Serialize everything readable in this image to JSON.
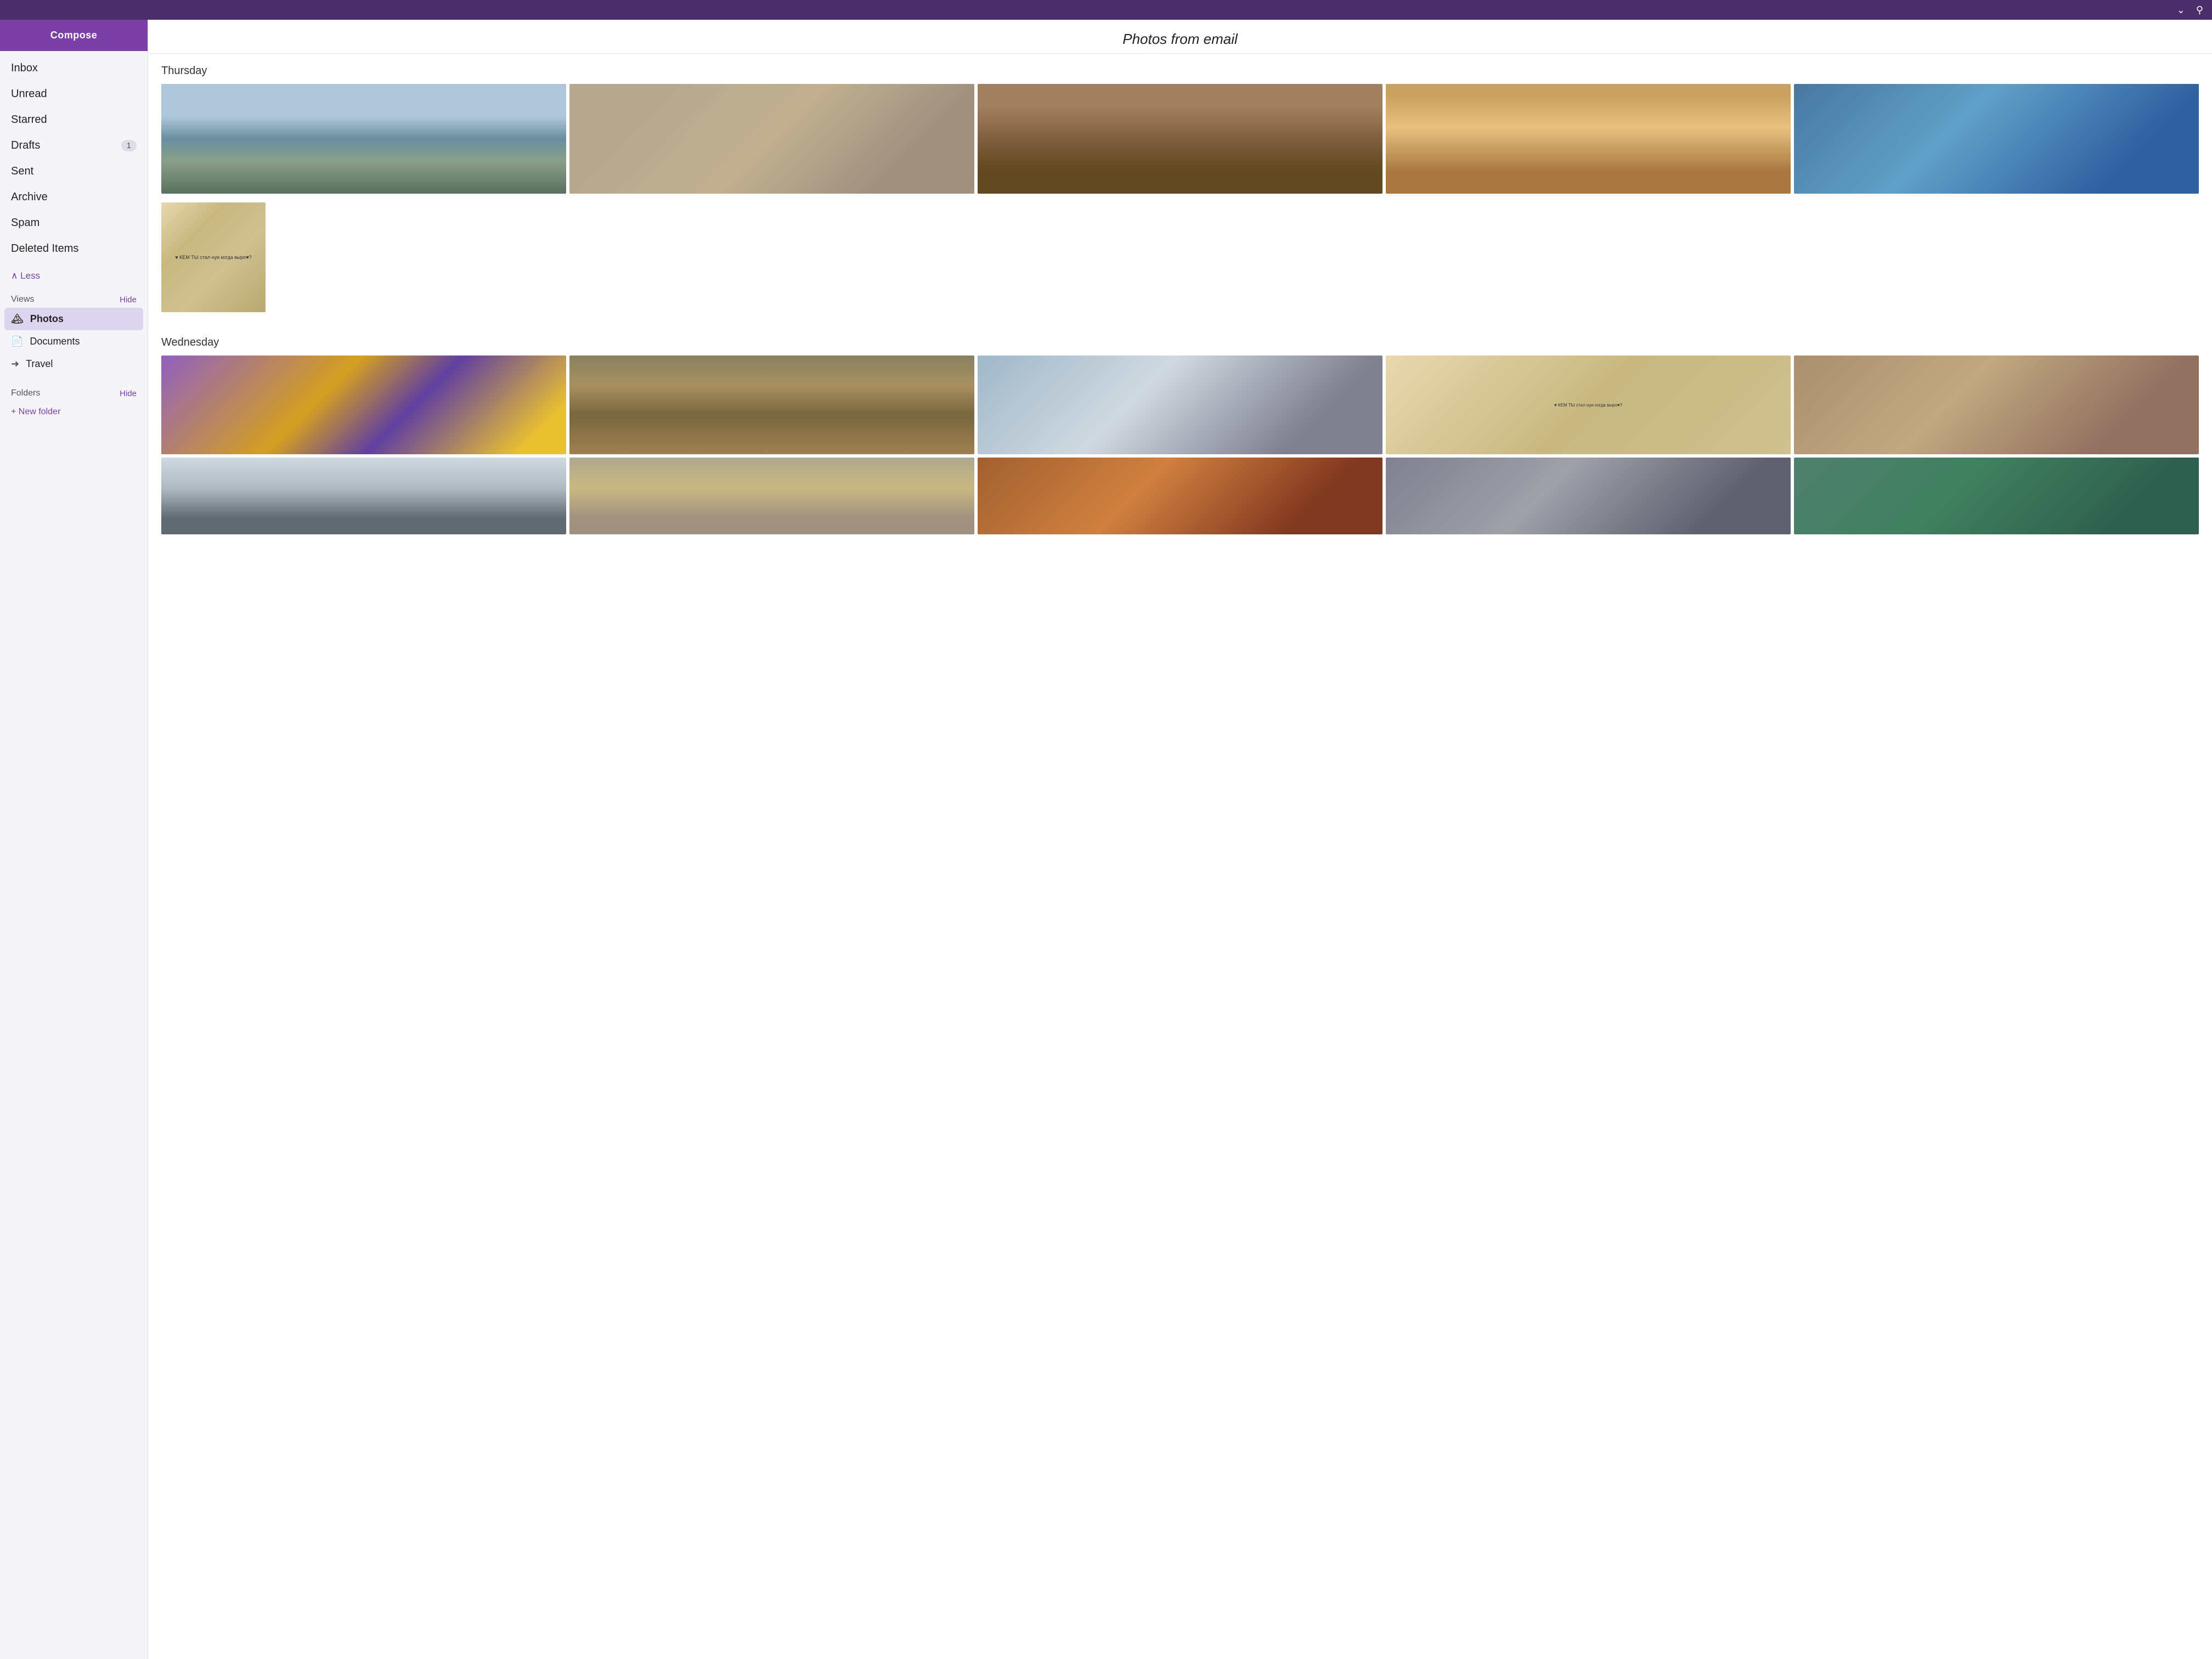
{
  "topbar": {
    "chevron_icon": "chevron-down",
    "search_icon": "search"
  },
  "sidebar": {
    "compose_label": "Compose",
    "nav_items": [
      {
        "label": "Inbox",
        "badge": null
      },
      {
        "label": "Unread",
        "badge": null
      },
      {
        "label": "Starred",
        "badge": null
      },
      {
        "label": "Drafts",
        "badge": "1"
      },
      {
        "label": "Sent",
        "badge": null
      },
      {
        "label": "Archive",
        "badge": null
      },
      {
        "label": "Spam",
        "badge": null
      },
      {
        "label": "Deleted Items",
        "badge": null
      }
    ],
    "less_toggle": "∧ Less",
    "views_label": "Views",
    "views_hide": "Hide",
    "views": [
      {
        "label": "Photos",
        "icon": "🏔",
        "active": true
      },
      {
        "label": "Documents",
        "icon": "📄",
        "active": false
      },
      {
        "label": "Travel",
        "icon": "➜",
        "active": false
      }
    ],
    "folders_label": "Folders",
    "folders_hide": "Hide",
    "new_folder_label": "+ New folder"
  },
  "main": {
    "page_title": "Photos from email",
    "sections": [
      {
        "day": "Thursday",
        "rows": [
          {
            "photos": [
              "river-canal",
              "wooden-post",
              "industrial-interior",
              "chimney-mural",
              "factory-windows"
            ]
          },
          {
            "photos": [
              "graffiti-wall"
            ]
          }
        ]
      },
      {
        "day": "Wednesday",
        "rows": [
          {
            "photos": [
              "colorful-ribbon",
              "lit-hall",
              "figure-sculpture",
              "graffiti-wall-2",
              "factory-window-2"
            ]
          },
          {
            "photos": [
              "stairs-interior",
              "wide-hall",
              "orange-hall",
              "concrete-columns",
              "green-window-strips"
            ]
          }
        ]
      }
    ]
  }
}
